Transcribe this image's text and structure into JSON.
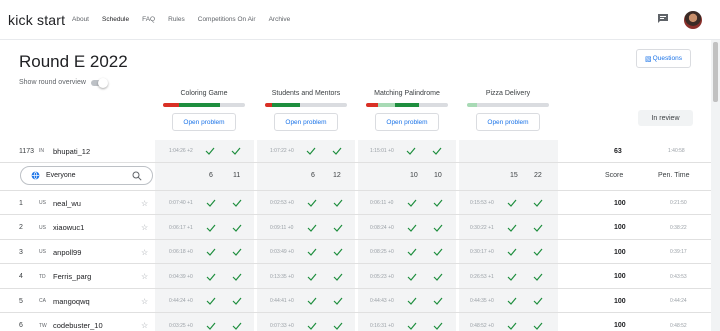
{
  "nav": {
    "brand": "kick start",
    "links": [
      "About",
      "Schedule",
      "FAQ",
      "Rules",
      "Competitions On Air",
      "Archive"
    ],
    "active": "Schedule"
  },
  "round": {
    "title": "Round E 2022",
    "overview_label": "Show round overview",
    "questions_label": "Questions",
    "in_review_label": "In review"
  },
  "problems": [
    {
      "name": "Coloring Game",
      "open_label": "Open problem",
      "bar": {
        "red": 0.2,
        "lightgreen": 0.0,
        "green": 0.5,
        "grey": 0.3
      }
    },
    {
      "name": "Students and Mentors",
      "open_label": "Open problem",
      "bar": {
        "red": 0.08,
        "lightgreen": 0.0,
        "green": 0.35,
        "grey": 0.57
      }
    },
    {
      "name": "Matching Palindrome",
      "open_label": "Open problem",
      "bar": {
        "red": 0.15,
        "lightgreen": 0.2,
        "green": 0.3,
        "grey": 0.35
      }
    },
    {
      "name": "Pizza Delivery",
      "open_label": "Open problem",
      "bar": {
        "red": 0.0,
        "lightgreen": 0.12,
        "green": 0.0,
        "grey": 0.88
      }
    }
  ],
  "me_row": {
    "rank": "1173",
    "country": "IN",
    "user": "bhupati_12",
    "times": [
      "1:04:26 +2",
      "1:07:22 +0",
      "1:15:01 +0",
      ""
    ],
    "score": "63",
    "pen_time": "1:40:58"
  },
  "filter": {
    "label": "Everyone",
    "counts": [
      [
        "6",
        "11"
      ],
      [
        "6",
        "12"
      ],
      [
        "10",
        "10"
      ],
      [
        "15",
        "22"
      ]
    ],
    "score_header": "Score",
    "pen_header": "Pen. Time"
  },
  "colors": {
    "accent": "#1a73e8",
    "check": "#1e8e3e",
    "band": "#f3f4f5"
  },
  "rows": [
    {
      "rank": "1",
      "country": "US",
      "user": "neal_wu",
      "times": [
        "0:07:40 +1",
        "0:02:53 +0",
        "0:06:11 +0",
        "0:15:53 +0"
      ],
      "score": "100",
      "pen": "0:21:50"
    },
    {
      "rank": "2",
      "country": "US",
      "user": "xiaowuc1",
      "times": [
        "0:06:17 +1",
        "0:09:11 +0",
        "0:08:24 +0",
        "0:30:22 +1"
      ],
      "score": "100",
      "pen": "0:38:22"
    },
    {
      "rank": "3",
      "country": "US",
      "user": "anpoll99",
      "times": [
        "0:06:18 +0",
        "0:03:49 +0",
        "0:08:25 +0",
        "0:30:17 +0"
      ],
      "score": "100",
      "pen": "0:39:17"
    },
    {
      "rank": "4",
      "country": "TD",
      "user": "Ferris_parg",
      "times": [
        "0:04:39 +0",
        "0:13:35 +0",
        "0:05:23 +0",
        "0:26:53 +1"
      ],
      "score": "100",
      "pen": "0:43:53"
    },
    {
      "rank": "5",
      "country": "CA",
      "user": "mangoqwq",
      "times": [
        "0:44:24 +0",
        "0:44:41 +0",
        "0:44:43 +0",
        "0:44:35 +0"
      ],
      "score": "100",
      "pen": "0:44:24"
    },
    {
      "rank": "6",
      "country": "TW",
      "user": "codebuster_10",
      "times": [
        "0:03:25 +0",
        "0:07:33 +0",
        "0:16:31 +0",
        "0:48:52 +0"
      ],
      "score": "100",
      "pen": "0:48:52"
    }
  ]
}
